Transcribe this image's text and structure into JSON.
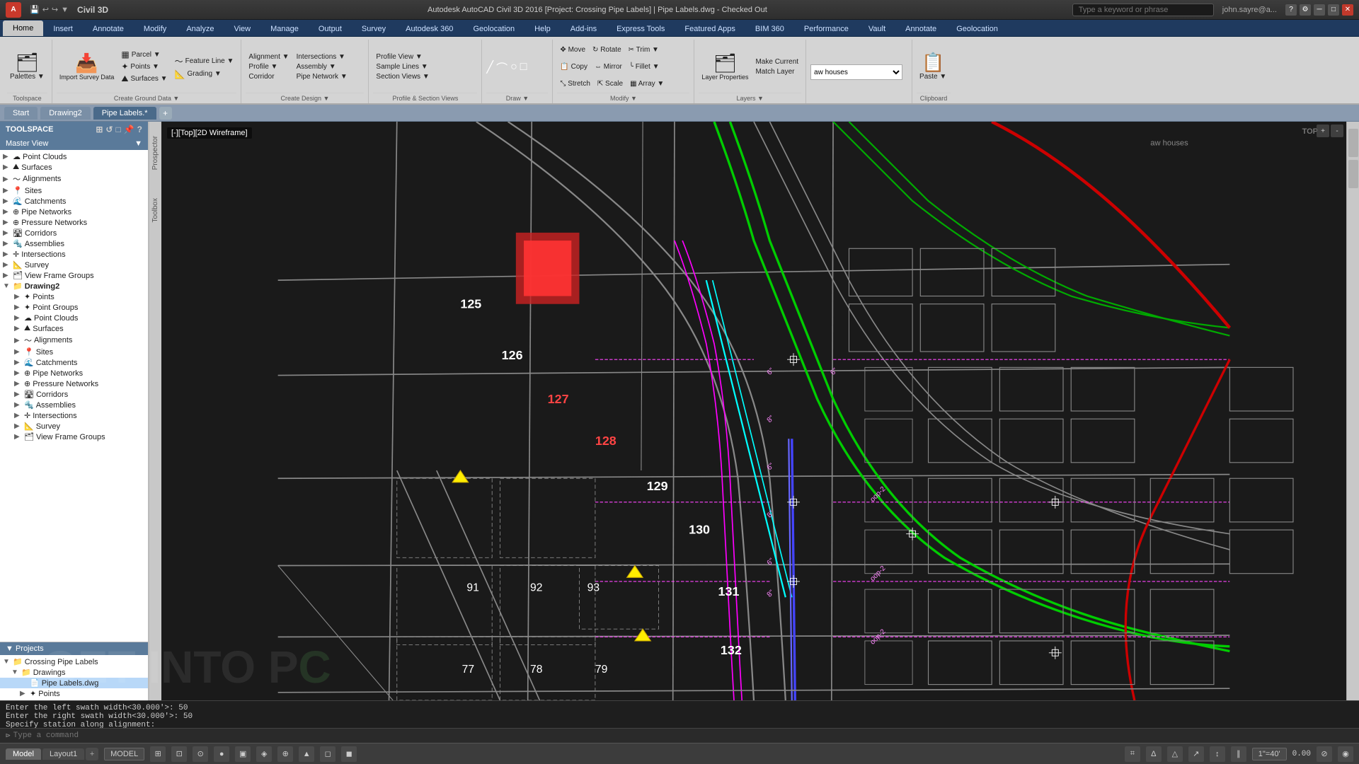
{
  "titlebar": {
    "app_name": "Civil 3D",
    "title": "Autodesk AutoCAD Civil 3D 2016 [Project: Crossing Pipe Labels]  |  Pipe Labels.dwg - Checked Out",
    "search_placeholder": "Type a keyword or phrase",
    "user": "john.sayre@a...",
    "app_icon": "A"
  },
  "ribbon_tabs": [
    {
      "label": "Home",
      "active": true
    },
    {
      "label": "Insert",
      "active": false
    },
    {
      "label": "Annotate",
      "active": false
    },
    {
      "label": "Modify",
      "active": false
    },
    {
      "label": "Analyze",
      "active": false
    },
    {
      "label": "View",
      "active": false
    },
    {
      "label": "Manage",
      "active": false
    },
    {
      "label": "Output",
      "active": false
    },
    {
      "label": "Survey",
      "active": false
    },
    {
      "label": "Autodesk 360",
      "active": false
    },
    {
      "label": "Geolocation",
      "active": false
    },
    {
      "label": "Help",
      "active": false
    },
    {
      "label": "Add-ins",
      "active": false
    },
    {
      "label": "Express Tools",
      "active": false
    },
    {
      "label": "Featured Apps",
      "active": false
    },
    {
      "label": "BIM 360",
      "active": false
    },
    {
      "label": "Performance",
      "active": false
    },
    {
      "label": "Vault",
      "active": false
    },
    {
      "label": "Annotate",
      "active": false
    },
    {
      "label": "Geolocation",
      "active": false
    }
  ],
  "ribbon": {
    "sections": [
      {
        "name": "toolspace",
        "title": "Toolspace",
        "buttons": [
          {
            "label": "Palettes ▼",
            "icon": "🗂"
          },
          {
            "label": "Create Ground Data ▼",
            "icon": "⛰"
          }
        ]
      },
      {
        "name": "import",
        "title": "",
        "buttons": [
          {
            "label": "Import Survey Data",
            "icon": "📥"
          },
          {
            "label": "Parcel ▼",
            "icon": "▦"
          },
          {
            "label": "Points ▼",
            "icon": "✦"
          },
          {
            "label": "Surfaces ▼",
            "icon": "⛰"
          },
          {
            "label": "Feature Line ▼",
            "icon": "〜"
          },
          {
            "label": "Grading ▼",
            "icon": "📐"
          }
        ]
      },
      {
        "name": "alignment",
        "title": "",
        "buttons": [
          {
            "label": "Alignment ▼",
            "icon": "⟶"
          },
          {
            "label": "Profile ▼",
            "icon": "📈"
          },
          {
            "label": "Corridor",
            "icon": "🛣"
          }
        ]
      },
      {
        "name": "intersections",
        "title": "",
        "buttons": [
          {
            "label": "Intersections ▼",
            "icon": "✛"
          },
          {
            "label": "Assembly ▼",
            "icon": "🔩"
          },
          {
            "label": "Pipe Network ▼",
            "icon": "⊕"
          }
        ]
      },
      {
        "name": "profile-view",
        "title": "",
        "buttons": [
          {
            "label": "Profile View ▼",
            "icon": "📊"
          },
          {
            "label": "Sample Lines ▼",
            "icon": "📏"
          },
          {
            "label": "Section Views ▼",
            "icon": "📉"
          }
        ]
      },
      {
        "name": "profile-section",
        "title": "Profile & Section Views",
        "buttons": []
      },
      {
        "name": "move",
        "title": "",
        "buttons": [
          {
            "label": "Move",
            "icon": "✥"
          },
          {
            "label": "Copy",
            "icon": "📋"
          },
          {
            "label": "Stretch",
            "icon": "⤡"
          }
        ]
      },
      {
        "name": "rotate",
        "title": "",
        "buttons": [
          {
            "label": "Rotate",
            "icon": "↻"
          },
          {
            "label": "Mirror",
            "icon": "⇔"
          },
          {
            "label": "Scale",
            "icon": "⇱"
          }
        ]
      },
      {
        "name": "trim",
        "title": "",
        "buttons": [
          {
            "label": "Trim ▼",
            "icon": "✂"
          },
          {
            "label": "Fillet ▼",
            "icon": "╰"
          },
          {
            "label": "Array ▼",
            "icon": "▦"
          }
        ]
      },
      {
        "name": "draw",
        "title": "Draw ▼",
        "buttons": [
          {
            "label": "─",
            "icon": ""
          },
          {
            "label": "⌒",
            "icon": ""
          },
          {
            "label": "⬭",
            "icon": ""
          },
          {
            "label": "⬜",
            "icon": ""
          }
        ]
      },
      {
        "name": "modify",
        "title": "Modify ▼",
        "buttons": []
      },
      {
        "name": "layers",
        "title": "Layers ▼",
        "buttons": [
          {
            "label": "Layer Properties",
            "icon": "🗂"
          },
          {
            "label": "Make Current",
            "icon": "✔"
          },
          {
            "label": "Match Layer",
            "icon": "≡"
          }
        ]
      },
      {
        "name": "clipboard",
        "title": "Clipboard",
        "buttons": [
          {
            "label": "Paste ▼",
            "icon": "📋"
          }
        ]
      }
    ]
  },
  "doc_tabs": [
    {
      "label": "Start",
      "active": false
    },
    {
      "label": "Drawing2",
      "active": false
    },
    {
      "label": "Pipe Labels.*",
      "active": true
    }
  ],
  "toolspace": {
    "title": "TOOLSPACE",
    "master_view": "Master View",
    "tree": [
      {
        "indent": 0,
        "arrow": "▶",
        "icon": "☁",
        "label": "Point Clouds"
      },
      {
        "indent": 0,
        "arrow": "▶",
        "icon": "⛰",
        "label": "Surfaces"
      },
      {
        "indent": 0,
        "arrow": "▶",
        "icon": "〜",
        "label": "Alignments"
      },
      {
        "indent": 0,
        "arrow": "▶",
        "icon": "📍",
        "label": "Sites"
      },
      {
        "indent": 0,
        "arrow": "▶",
        "icon": "🌊",
        "label": "Catchments"
      },
      {
        "indent": 0,
        "arrow": "▶",
        "icon": "⊕",
        "label": "Pipe Networks"
      },
      {
        "indent": 0,
        "arrow": "▶",
        "icon": "⊕",
        "label": "Pressure Networks"
      },
      {
        "indent": 0,
        "arrow": "▶",
        "icon": "🛣",
        "label": "Corridors"
      },
      {
        "indent": 0,
        "arrow": "▶",
        "icon": "🔩",
        "label": "Assemblies"
      },
      {
        "indent": 0,
        "arrow": "▶",
        "icon": "✛",
        "label": "Intersections"
      },
      {
        "indent": 0,
        "arrow": "▶",
        "icon": "📐",
        "label": "Survey"
      },
      {
        "indent": 0,
        "arrow": "▶",
        "icon": "🗂",
        "label": "View Frame Groups"
      },
      {
        "indent": 0,
        "arrow": "▼",
        "icon": "📁",
        "label": "Drawing2",
        "bold": true
      },
      {
        "indent": 1,
        "arrow": "▶",
        "icon": "✦",
        "label": "Points"
      },
      {
        "indent": 1,
        "arrow": "▶",
        "icon": "✦",
        "label": "Point Groups"
      },
      {
        "indent": 1,
        "arrow": "▶",
        "icon": "☁",
        "label": "Point Clouds"
      },
      {
        "indent": 1,
        "arrow": "▶",
        "icon": "⛰",
        "label": "Surfaces"
      },
      {
        "indent": 1,
        "arrow": "▶",
        "icon": "〜",
        "label": "Alignments"
      },
      {
        "indent": 1,
        "arrow": "▶",
        "icon": "📍",
        "label": "Sites"
      },
      {
        "indent": 1,
        "arrow": "▶",
        "icon": "🌊",
        "label": "Catchments"
      },
      {
        "indent": 1,
        "arrow": "▶",
        "icon": "⊕",
        "label": "Pipe Networks"
      },
      {
        "indent": 1,
        "arrow": "▶",
        "icon": "⊕",
        "label": "Pressure Networks"
      },
      {
        "indent": 1,
        "arrow": "▶",
        "icon": "🛣",
        "label": "Corridors"
      },
      {
        "indent": 1,
        "arrow": "▶",
        "icon": "🔩",
        "label": "Assemblies"
      },
      {
        "indent": 1,
        "arrow": "▶",
        "icon": "✛",
        "label": "Intersections"
      },
      {
        "indent": 1,
        "arrow": "▶",
        "icon": "📐",
        "label": "Survey"
      },
      {
        "indent": 1,
        "arrow": "▶",
        "icon": "🗂",
        "label": "View Frame Groups"
      }
    ]
  },
  "projects": {
    "title": "Projects",
    "items": [
      {
        "indent": 0,
        "arrow": "▼",
        "icon": "📁",
        "label": "Crossing Pipe Labels"
      },
      {
        "indent": 1,
        "arrow": "▼",
        "icon": "📁",
        "label": "Drawings"
      },
      {
        "indent": 2,
        "arrow": "  ",
        "icon": "📄",
        "label": "Pipe Labels.dwg",
        "selected": true
      },
      {
        "indent": 2,
        "arrow": "▶",
        "icon": "✦",
        "label": "Points"
      }
    ]
  },
  "canvas": {
    "view_label": "[-][Top][2D Wireframe]",
    "top_label": "TOP",
    "lot_numbers": [
      125,
      126,
      127,
      128,
      129,
      130,
      131,
      132,
      91,
      92,
      93,
      77,
      78,
      79
    ]
  },
  "command": {
    "lines": [
      "Enter the left swath width<30.000'>: 50",
      "Enter the right swath width<30.000'>: 50",
      "Specify station along alignment:"
    ],
    "prompt": "⊳",
    "placeholder": "Type a command"
  },
  "status_bar": {
    "model_label": "MODEL",
    "tabs": [
      {
        "label": "Model",
        "active": true
      },
      {
        "label": "Layout1",
        "active": false
      }
    ],
    "scale": "1\"=40'",
    "coord": "0.00",
    "icons": [
      "⊞",
      "⊡",
      "⊙",
      "●",
      "▣",
      "◈",
      "⊕",
      "▲",
      "◻",
      "◼",
      "⌗",
      "Δ",
      "△",
      "↗",
      "↕",
      "∥",
      "⊘"
    ]
  }
}
